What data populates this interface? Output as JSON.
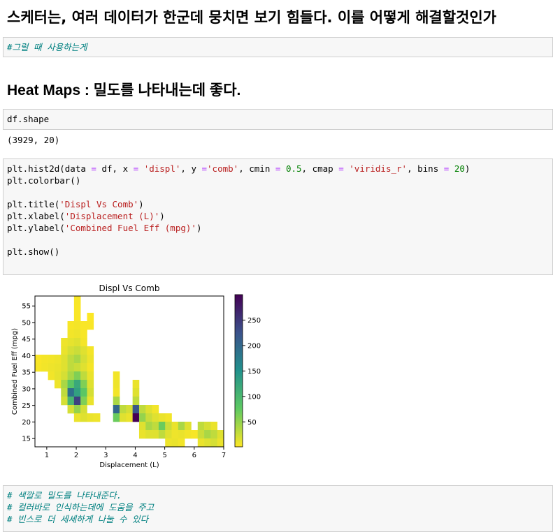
{
  "heading1": "스케터는, 여러 데이터가 한군데 뭉치면 보기 힘들다. 이를 어떻게 해결할것인가",
  "markdown_cell1": "#그럴 때 사용하는게",
  "heading2": "Heat Maps : 밀도를 나타내는데 좋다.",
  "code_cell1": "df.shape",
  "output1": "(3929, 20)",
  "code_cell2": {
    "line1_parts": [
      "plt.hist2d(data ",
      "=",
      " df, x ",
      "=",
      " ",
      "'displ'",
      ", y ",
      "=",
      "'comb'",
      ", cmin ",
      "=",
      " ",
      "0.5",
      ", cmap ",
      "=",
      " ",
      "'viridis_r'",
      ", bins ",
      "=",
      " ",
      "20",
      ")"
    ],
    "line2": "plt.colorbar()",
    "line4_parts": [
      "plt.title(",
      "'Displ Vs Comb'",
      ")"
    ],
    "line5_parts": [
      "plt.xlabel(",
      "'Displacement (L)'",
      ")"
    ],
    "line6_parts": [
      "plt.ylabel(",
      "'Combined Fuel Eff (mpg)'",
      ")"
    ],
    "line8": "plt.show()"
  },
  "markdown_cell2": [
    "# 색깔로 밀도를 나타내준다.",
    "# 컬러바로 인식하는데에 도움을 주고",
    "# 빈스로 더 세세하게 나눌 수 있다"
  ],
  "chart_data": {
    "type": "heatmap",
    "title": "Displ Vs Comb",
    "xlabel": "Displacement (L)",
    "ylabel": "Combined Fuel Eff (mpg)",
    "xlim": [
      0.6,
      7.0
    ],
    "ylim": [
      12.5,
      58.0
    ],
    "bins": 20,
    "cmap": "viridis_r",
    "xticks": [
      1,
      2,
      3,
      4,
      5,
      6,
      7
    ],
    "yticks": [
      15,
      20,
      25,
      30,
      35,
      40,
      45,
      50,
      55
    ],
    "colorbar_ticks": [
      50,
      100,
      150,
      200,
      250
    ],
    "colorbar_range": [
      1,
      300
    ],
    "cells": [
      {
        "xi": 6,
        "yi": 0,
        "v": 4
      },
      {
        "xi": 6,
        "yi": 1,
        "v": 3
      },
      {
        "xi": 6,
        "yi": 2,
        "v": 3
      },
      {
        "xi": 5,
        "yi": 3,
        "v": 4
      },
      {
        "xi": 6,
        "yi": 3,
        "v": 5
      },
      {
        "xi": 8,
        "yi": 3,
        "v": 3
      },
      {
        "xi": 5,
        "yi": 4,
        "v": 6
      },
      {
        "xi": 6,
        "yi": 4,
        "v": 8
      },
      {
        "xi": 7,
        "yi": 4,
        "v": 4
      },
      {
        "xi": 4,
        "yi": 5,
        "v": 8
      },
      {
        "xi": 5,
        "yi": 5,
        "v": 12
      },
      {
        "xi": 6,
        "yi": 5,
        "v": 15
      },
      {
        "xi": 7,
        "yi": 5,
        "v": 5
      },
      {
        "xi": 4,
        "yi": 6,
        "v": 10
      },
      {
        "xi": 5,
        "yi": 6,
        "v": 20
      },
      {
        "xi": 6,
        "yi": 6,
        "v": 25
      },
      {
        "xi": 7,
        "yi": 6,
        "v": 15
      },
      {
        "xi": 8,
        "yi": 6,
        "v": 5
      },
      {
        "xi": 4,
        "yi": 7,
        "v": 15
      },
      {
        "xi": 5,
        "yi": 7,
        "v": 30
      },
      {
        "xi": 6,
        "yi": 7,
        "v": 40
      },
      {
        "xi": 7,
        "yi": 7,
        "v": 20
      },
      {
        "xi": 8,
        "yi": 7,
        "v": 8
      },
      {
        "xi": 0,
        "yi": 8,
        "v": 4
      },
      {
        "xi": 1,
        "yi": 8,
        "v": 6
      },
      {
        "xi": 2,
        "yi": 8,
        "v": 8
      },
      {
        "xi": 3,
        "yi": 8,
        "v": 10
      },
      {
        "xi": 4,
        "yi": 8,
        "v": 15
      },
      {
        "xi": 5,
        "yi": 8,
        "v": 30
      },
      {
        "xi": 6,
        "yi": 8,
        "v": 25
      },
      {
        "xi": 7,
        "yi": 8,
        "v": 15
      },
      {
        "xi": 8,
        "yi": 8,
        "v": 5
      },
      {
        "xi": 2,
        "yi": 9,
        "v": 6
      },
      {
        "xi": 3,
        "yi": 9,
        "v": 12
      },
      {
        "xi": 4,
        "yi": 9,
        "v": 20
      },
      {
        "xi": 5,
        "yi": 9,
        "v": 40
      },
      {
        "xi": 6,
        "yi": 9,
        "v": 60
      },
      {
        "xi": 7,
        "yi": 9,
        "v": 30
      },
      {
        "xi": 8,
        "yi": 9,
        "v": 10
      },
      {
        "xi": 3,
        "yi": 10,
        "v": 8
      },
      {
        "xi": 4,
        "yi": 10,
        "v": 40
      },
      {
        "xi": 5,
        "yi": 10,
        "v": 80
      },
      {
        "xi": 6,
        "yi": 10,
        "v": 120
      },
      {
        "xi": 7,
        "yi": 10,
        "v": 60
      },
      {
        "xi": 8,
        "yi": 10,
        "v": 15
      },
      {
        "xi": 12,
        "yi": 10,
        "v": 8
      },
      {
        "xi": 15,
        "yi": 10,
        "v": 10
      },
      {
        "xi": 4,
        "yi": 11,
        "v": 30
      },
      {
        "xi": 5,
        "yi": 11,
        "v": 190
      },
      {
        "xi": 6,
        "yi": 11,
        "v": 130
      },
      {
        "xi": 7,
        "yi": 11,
        "v": 80
      },
      {
        "xi": 8,
        "yi": 11,
        "v": 20
      },
      {
        "xi": 12,
        "yi": 11,
        "v": 6
      },
      {
        "xi": 15,
        "yi": 11,
        "v": 15
      },
      {
        "xi": 4,
        "yi": 12,
        "v": 20
      },
      {
        "xi": 5,
        "yi": 12,
        "v": 100
      },
      {
        "xi": 6,
        "yi": 12,
        "v": 240
      },
      {
        "xi": 7,
        "yi": 12,
        "v": 60
      },
      {
        "xi": 8,
        "yi": 12,
        "v": 10
      },
      {
        "xi": 12,
        "yi": 12,
        "v": 40
      },
      {
        "xi": 15,
        "yi": 12,
        "v": 30
      },
      {
        "xi": 5,
        "yi": 13,
        "v": 20
      },
      {
        "xi": 6,
        "yi": 13,
        "v": 50
      },
      {
        "xi": 7,
        "yi": 13,
        "v": 20
      },
      {
        "xi": 12,
        "yi": 13,
        "v": 200
      },
      {
        "xi": 13,
        "yi": 13,
        "v": 30
      },
      {
        "xi": 14,
        "yi": 13,
        "v": 20
      },
      {
        "xi": 15,
        "yi": 13,
        "v": 220
      },
      {
        "xi": 16,
        "yi": 13,
        "v": 30
      },
      {
        "xi": 17,
        "yi": 13,
        "v": 15
      },
      {
        "xi": 18,
        "yi": 13,
        "v": 6
      },
      {
        "xi": 6,
        "yi": 14,
        "v": 10
      },
      {
        "xi": 7,
        "yi": 14,
        "v": 15
      },
      {
        "xi": 8,
        "yi": 14,
        "v": 10
      },
      {
        "xi": 9,
        "yi": 14,
        "v": 8
      },
      {
        "xi": 12,
        "yi": 14,
        "v": 70
      },
      {
        "xi": 13,
        "yi": 14,
        "v": 15
      },
      {
        "xi": 14,
        "yi": 14,
        "v": 10
      },
      {
        "xi": 15,
        "yi": 14,
        "v": 300
      },
      {
        "xi": 16,
        "yi": 14,
        "v": 50
      },
      {
        "xi": 17,
        "yi": 14,
        "v": 25
      },
      {
        "xi": 18,
        "yi": 14,
        "v": 15
      },
      {
        "xi": 19,
        "yi": 14,
        "v": 10
      },
      {
        "xi": 20,
        "yi": 14,
        "v": 6
      },
      {
        "xi": 16,
        "yi": 15,
        "v": 15
      },
      {
        "xi": 17,
        "yi": 15,
        "v": 40
      },
      {
        "xi": 18,
        "yi": 15,
        "v": 30
      },
      {
        "xi": 19,
        "yi": 15,
        "v": 70
      },
      {
        "xi": 20,
        "yi": 15,
        "v": 25
      },
      {
        "xi": 21,
        "yi": 15,
        "v": 10
      },
      {
        "xi": 22,
        "yi": 15,
        "v": 40
      },
      {
        "xi": 23,
        "yi": 15,
        "v": 15
      },
      {
        "xi": 25,
        "yi": 15,
        "v": 30
      },
      {
        "xi": 26,
        "yi": 15,
        "v": 20
      },
      {
        "xi": 27,
        "yi": 15,
        "v": 10
      },
      {
        "xi": 16,
        "yi": 16,
        "v": 10
      },
      {
        "xi": 17,
        "yi": 16,
        "v": 15
      },
      {
        "xi": 18,
        "yi": 16,
        "v": 15
      },
      {
        "xi": 19,
        "yi": 16,
        "v": 30
      },
      {
        "xi": 20,
        "yi": 16,
        "v": 15
      },
      {
        "xi": 21,
        "yi": 16,
        "v": 8
      },
      {
        "xi": 22,
        "yi": 16,
        "v": 10
      },
      {
        "xi": 23,
        "yi": 16,
        "v": 6
      },
      {
        "xi": 24,
        "yi": 16,
        "v": 4
      },
      {
        "xi": 25,
        "yi": 16,
        "v": 25
      },
      {
        "xi": 26,
        "yi": 16,
        "v": 40
      },
      {
        "xi": 27,
        "yi": 16,
        "v": 30
      },
      {
        "xi": 28,
        "yi": 16,
        "v": 15
      },
      {
        "xi": 20,
        "yi": 17,
        "v": 8
      },
      {
        "xi": 21,
        "yi": 17,
        "v": 10
      },
      {
        "xi": 22,
        "yi": 17,
        "v": 6
      },
      {
        "xi": 25,
        "yi": 17,
        "v": 10
      },
      {
        "xi": 26,
        "yi": 17,
        "v": 15
      },
      {
        "xi": 27,
        "yi": 17,
        "v": 20
      },
      {
        "xi": 28,
        "yi": 17,
        "v": 10
      }
    ]
  },
  "extra_cells": [
    {
      "xi": 6,
      "yi": 2,
      "v": 3
    },
    {
      "xi": 8,
      "yi": 2,
      "v": 2
    },
    {
      "xi": 7,
      "yi": 3,
      "v": 3
    },
    {
      "xi": 0,
      "yi": 7,
      "v": 3
    },
    {
      "xi": 1,
      "yi": 7,
      "v": 5
    },
    {
      "xi": 2,
      "yi": 7,
      "v": 6
    },
    {
      "xi": 3,
      "yi": 7,
      "v": 8
    },
    {
      "xi": 1,
      "yi": 8,
      "v": 6
    },
    {
      "xi": 2,
      "yi": 9,
      "v": 5
    },
    {
      "xi": 12,
      "yi": 9,
      "v": 6
    },
    {
      "xi": 12,
      "yi": 10,
      "v": 10
    }
  ]
}
